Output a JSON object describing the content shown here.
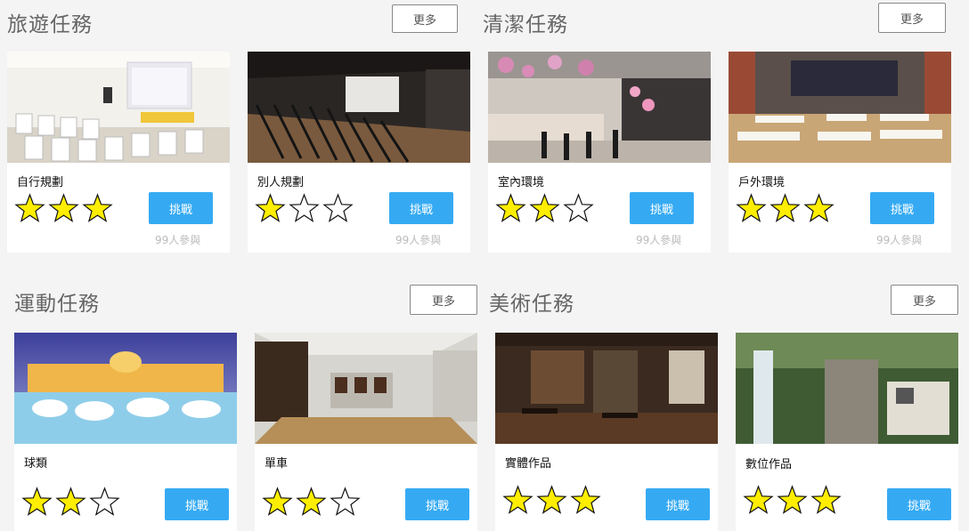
{
  "sections": [
    {
      "title": "旅遊任務",
      "more_label": "更多"
    },
    {
      "title": "清潔任務",
      "more_label": "更多"
    },
    {
      "title": "運動任務",
      "more_label": "更多"
    },
    {
      "title": "美術任務",
      "more_label": "更多"
    }
  ],
  "cards": [
    {
      "name": "自行規劃",
      "rating": 3,
      "max_rating": 3,
      "button_label": "挑戰",
      "participants": "99人參與"
    },
    {
      "name": "別人規劃",
      "rating": 1,
      "max_rating": 3,
      "button_label": "挑戰",
      "participants": "99人參與"
    },
    {
      "name": "室內環境",
      "rating": 2,
      "max_rating": 3,
      "button_label": "挑戰",
      "participants": "99人參與"
    },
    {
      "name": "戶外環境",
      "rating": 3,
      "max_rating": 3,
      "button_label": "挑戰",
      "participants": "99人參與"
    },
    {
      "name": "球類",
      "rating": 2,
      "max_rating": 3,
      "button_label": "挑戰"
    },
    {
      "name": "單車",
      "rating": 2,
      "max_rating": 3,
      "button_label": "挑戰"
    },
    {
      "name": "實體作品",
      "rating": 3,
      "max_rating": 3,
      "button_label": "挑戰"
    },
    {
      "name": "數位作品",
      "rating": 3,
      "max_rating": 3,
      "button_label": "挑戰"
    }
  ],
  "colors": {
    "accent": "#35aaf3",
    "star_fill": "#ffee00",
    "background": "#f4f4f4"
  },
  "icons": {
    "rating": "star-icon"
  }
}
